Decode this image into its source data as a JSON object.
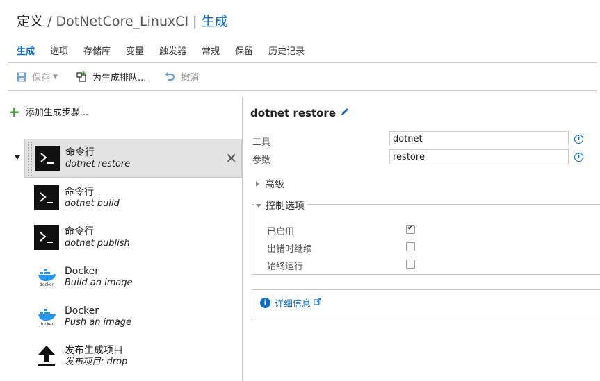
{
  "header": {
    "prefix": "定义",
    "sep1": "/",
    "definition": "DotNetCore_LinuxCI",
    "sep2": "|",
    "section": "生成"
  },
  "tabs": [
    {
      "label": "生成",
      "active": true
    },
    {
      "label": "选项"
    },
    {
      "label": "存储库"
    },
    {
      "label": "变量"
    },
    {
      "label": "触发器"
    },
    {
      "label": "常规"
    },
    {
      "label": "保留"
    },
    {
      "label": "历史记录"
    }
  ],
  "toolbar": {
    "save_label": "保存",
    "queue_label": "为生成排队...",
    "undo_label": "撤消"
  },
  "left": {
    "add_step_label": "添加生成步骤...",
    "steps": [
      {
        "name": "命令行",
        "desc": "dotnet restore",
        "icon": "terminal-icon"
      },
      {
        "name": "命令行",
        "desc": "dotnet build",
        "icon": "terminal-icon"
      },
      {
        "name": "命令行",
        "desc": "dotnet publish",
        "icon": "terminal-icon"
      },
      {
        "name": "Docker",
        "desc": "Build an image",
        "icon": "docker-icon"
      },
      {
        "name": "Docker",
        "desc": "Push an image",
        "icon": "docker-icon"
      },
      {
        "name": "发布生成项目",
        "desc": "发布项目: drop",
        "icon": "upload-icon"
      }
    ]
  },
  "detail": {
    "title": "dotnet restore",
    "tool_label": "工具",
    "tool_value": "dotnet",
    "args_label": "参数",
    "args_value": "restore",
    "advanced_label": "高级",
    "control_label": "控制选项",
    "options": [
      {
        "label": "已启用",
        "checked": true
      },
      {
        "label": "出错时继续",
        "checked": false
      },
      {
        "label": "始终运行",
        "checked": false
      }
    ],
    "more_info_label": "详细信息"
  },
  "colors": {
    "accent": "#106ebe",
    "add_green": "#3c9a2e",
    "selected_bg": "#e3e3e3"
  }
}
